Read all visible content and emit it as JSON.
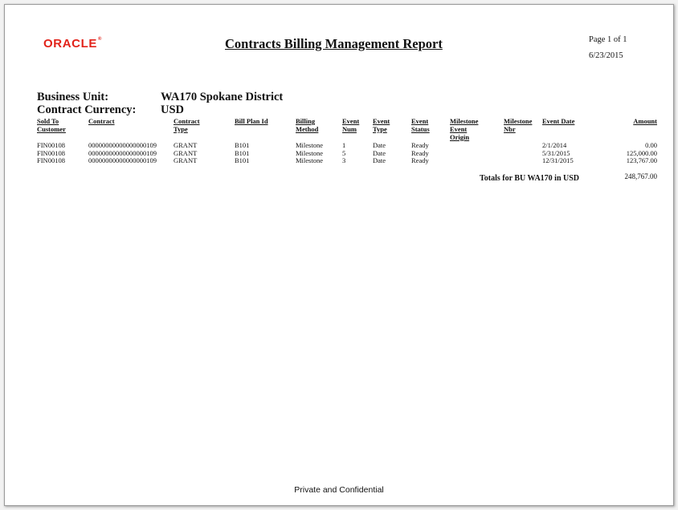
{
  "header": {
    "logo_text": "ORACLE",
    "logo_mark": "®",
    "title": "Contracts Billing Management Report",
    "page_indicator": "Page 1 of 1",
    "run_date": "6/23/2015"
  },
  "params": {
    "business_unit_label": "Business Unit:",
    "business_unit_value": "WA170 Spokane District",
    "currency_label": "Contract Currency:",
    "currency_value": "USD"
  },
  "columns": [
    [
      "Sold To",
      "Customer"
    ],
    [
      "Contract"
    ],
    [
      "Contract",
      "Type"
    ],
    [
      "Bill Plan Id"
    ],
    [
      "Billing",
      "Method"
    ],
    [
      "Event",
      "Num"
    ],
    [
      "Event",
      "Type"
    ],
    [
      "Event",
      "Status"
    ],
    [
      "Milestone",
      "Event",
      "Origin"
    ],
    [
      "Milestone",
      "Nbr"
    ],
    [
      "Event Date"
    ],
    [
      "Amount"
    ]
  ],
  "rows": [
    [
      "FIN00108",
      "00000000000000000109",
      "GRANT",
      "B101",
      "Milestone",
      "1",
      "Date",
      "Ready",
      "",
      "",
      "2/1/2014",
      "0.00"
    ],
    [
      "FIN00108",
      "00000000000000000109",
      "GRANT",
      "B101",
      "Milestone",
      "5",
      "Date",
      "Ready",
      "",
      "",
      "5/31/2015",
      "125,000.00"
    ],
    [
      "FIN00108",
      "00000000000000000109",
      "GRANT",
      "B101",
      "Milestone",
      "3",
      "Date",
      "Ready",
      "",
      "",
      "12/31/2015",
      "123,767.00"
    ]
  ],
  "totals": {
    "label": "Totals for BU WA170 in USD",
    "value": "248,767.00"
  },
  "footer": {
    "text": "Private and Confidential"
  }
}
